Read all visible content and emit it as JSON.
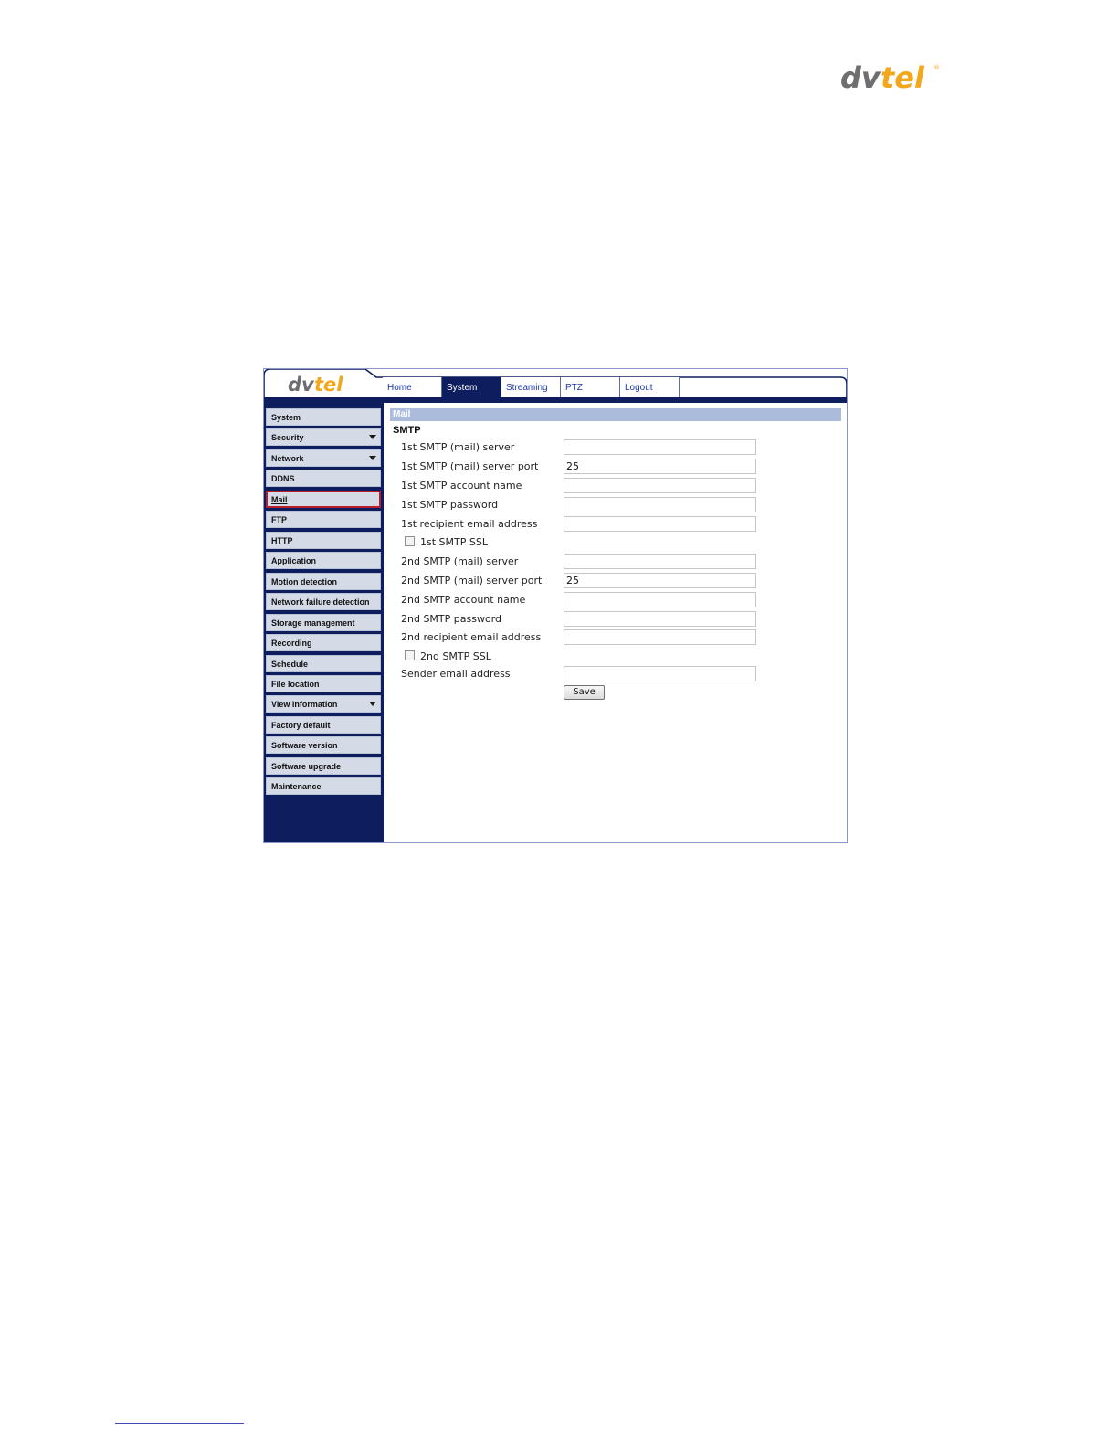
{
  "page_logo": {
    "part1": "dv",
    "part2": "tel",
    "reg_mark": "®",
    "colors": {
      "dv": "#6d6e70",
      "tel": "#f2a81d"
    }
  },
  "ui": {
    "logo": {
      "part1": "dv",
      "part2": "tel"
    },
    "tabs": [
      {
        "label": "Home"
      },
      {
        "label": "System"
      },
      {
        "label": "Streaming"
      },
      {
        "label": "PTZ"
      },
      {
        "label": "Logout"
      }
    ],
    "active_tab": "System",
    "sidebar": {
      "items": [
        {
          "label": "System"
        },
        {
          "label": "Security"
        },
        {
          "label": "Network"
        },
        {
          "label": "DDNS"
        },
        {
          "label": "Mail"
        },
        {
          "label": "FTP"
        },
        {
          "label": "HTTP"
        },
        {
          "label": "Application"
        },
        {
          "label": "Motion detection"
        },
        {
          "label": "Network failure detection"
        },
        {
          "label": "Storage management"
        },
        {
          "label": "Recording"
        },
        {
          "label": "Schedule"
        },
        {
          "label": "File location"
        },
        {
          "label": "View information"
        },
        {
          "label": "Factory default"
        },
        {
          "label": "Software version"
        },
        {
          "label": "Software upgrade"
        },
        {
          "label": "Maintenance"
        }
      ],
      "selected": "Mail",
      "expandable": [
        "Security",
        "Network",
        "View information"
      ]
    },
    "content": {
      "section_title": "Mail",
      "group_title": "SMTP",
      "fields": {
        "smtp1_server": {
          "label": "1st SMTP (mail) server",
          "value": ""
        },
        "smtp1_port": {
          "label": "1st SMTP (mail) server port",
          "value": "25"
        },
        "smtp1_account": {
          "label": "1st SMTP account name",
          "value": ""
        },
        "smtp1_password": {
          "label": "1st SMTP password",
          "value": ""
        },
        "recipient1": {
          "label": "1st recipient email address",
          "value": ""
        },
        "smtp1_ssl": {
          "label": "1st SMTP SSL",
          "checked": false
        },
        "smtp2_server": {
          "label": "2nd SMTP (mail) server",
          "value": ""
        },
        "smtp2_port": {
          "label": "2nd SMTP (mail) server port",
          "value": "25"
        },
        "smtp2_account": {
          "label": "2nd SMTP account name",
          "value": ""
        },
        "smtp2_password": {
          "label": "2nd SMTP password",
          "value": ""
        },
        "recipient2": {
          "label": "2nd recipient email address",
          "value": ""
        },
        "smtp2_ssl": {
          "label": "2nd SMTP SSL",
          "checked": false
        },
        "sender": {
          "label": "Sender email address",
          "value": ""
        }
      },
      "save_label": "Save"
    },
    "colors": {
      "nav_dark": "#0e1d5e",
      "section_bar": "#aabbdc",
      "selected_border": "#b81d2a",
      "tab_text": "#1b37b0"
    }
  }
}
